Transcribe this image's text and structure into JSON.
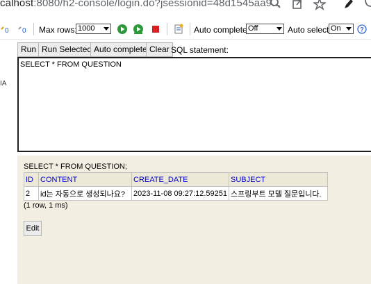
{
  "browser": {
    "url_prefix": "calhost",
    "url_rest": ":8080/h2-console/login.do?jsessionid=48d1545aa9..."
  },
  "toolbar": {
    "max_rows_label": "Max rows:",
    "max_rows_value": "1000",
    "auto_complete_label": "Auto complete",
    "auto_complete_value": "Off",
    "auto_select_label": "Auto select",
    "auto_select_value": "On",
    "help_glyph": "?"
  },
  "sidebar": {
    "fragment": "IA"
  },
  "query_bar": {
    "run_label": "Run",
    "run_selected_label": "Run Selected",
    "auto_complete_label": "Auto complete",
    "clear_label": "Clear",
    "sql_statement_label": "SQL statement:"
  },
  "editor": {
    "sql": "SELECT * FROM QUESTION"
  },
  "result": {
    "statement": "SELECT * FROM QUESTION;",
    "columns": [
      "ID",
      "CONTENT",
      "CREATE_DATE",
      "SUBJECT"
    ],
    "rows": [
      [
        "2",
        "id는 자동으로 생성되나요?",
        "2023-11-08 09:27:12.59251",
        "스프링부트 모델 질문입니다."
      ]
    ],
    "summary": "(1 row, 1 ms)",
    "edit_label": "Edit"
  },
  "colors": {
    "header_text": "#0000cc",
    "result_bg": "#f2efe2"
  }
}
